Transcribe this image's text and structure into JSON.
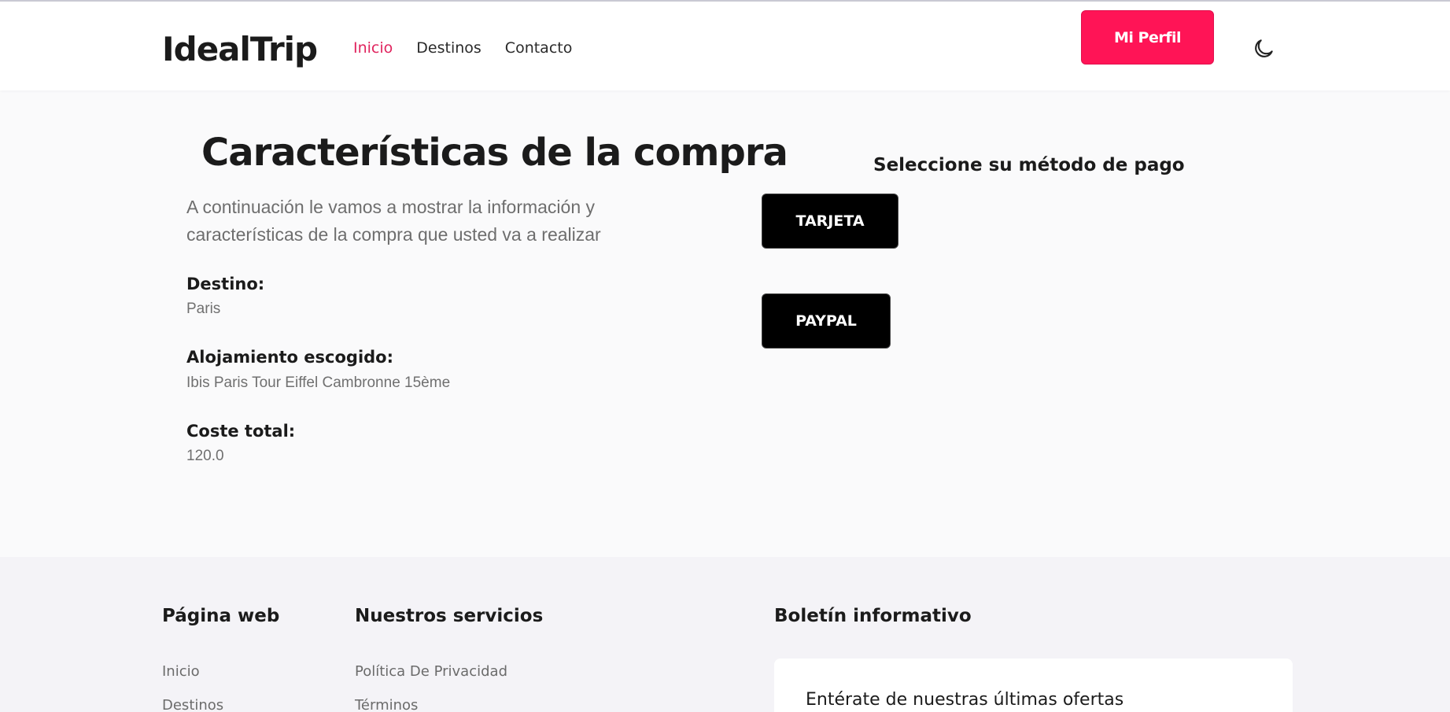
{
  "header": {
    "logo": "IdealTrip",
    "nav": [
      {
        "label": "Inicio",
        "active": true
      },
      {
        "label": "Destinos",
        "active": false
      },
      {
        "label": "Contacto",
        "active": false
      }
    ],
    "profile_button": "Mi Perfil",
    "theme_toggle_icon": "moon-icon"
  },
  "purchase": {
    "title": "Características de la compra",
    "intro": "A continuación le vamos a mostrar la información y características de la compra que usted va a realizar",
    "destination_label": "Destino:",
    "destination_value": "Paris",
    "lodging_label": "Alojamiento escogido:",
    "lodging_value": "Ibis Paris Tour Eiffel Cambronne 15ème",
    "total_label": "Coste total:",
    "total_value": "120.0"
  },
  "payment": {
    "title": "Seleccione su método de pago",
    "card_button": "TARJETA",
    "paypal_button": "PAYPAL"
  },
  "footer": {
    "website_heading": "Página web",
    "website_links": [
      "Inicio",
      "Destinos"
    ],
    "services_heading": "Nuestros servicios",
    "services_links": [
      "Política De Privacidad",
      "Términos"
    ],
    "newsletter_heading": "Boletín informativo",
    "newsletter_text": "Entérate de nuestras últimas ofertas"
  },
  "colors": {
    "accent": "#ff1456",
    "active_nav": "#e0245e",
    "payment_button": "#000000"
  }
}
